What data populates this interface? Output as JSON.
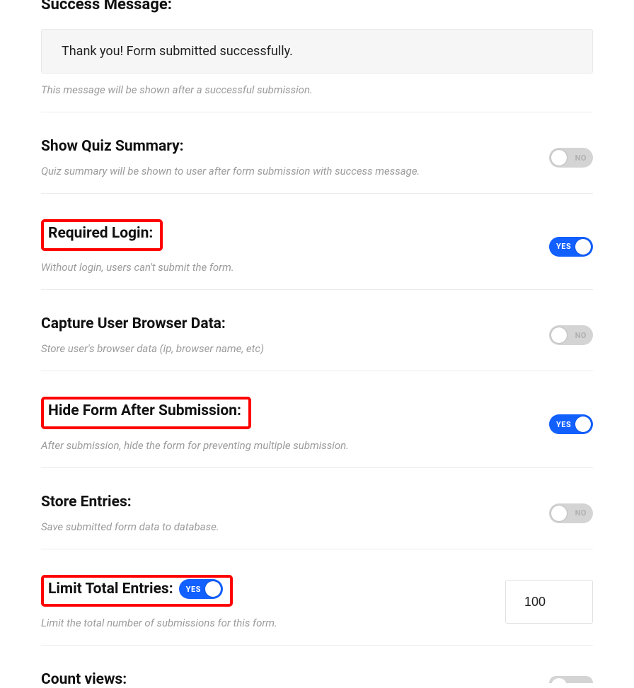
{
  "successMessageSection": {
    "title": "Success Message:",
    "value": "Thank you! Form submitted successfully.",
    "help": "This message will be shown after a successful submission."
  },
  "toggleLabels": {
    "yes": "YES",
    "no": "NO"
  },
  "settings": {
    "quizSummary": {
      "title": "Show Quiz Summary:",
      "help": "Quiz summary will be shown to user after form submission with success message.",
      "on": false
    },
    "requiredLogin": {
      "title": "Required Login:",
      "help": "Without login, users can't submit the form.",
      "on": true
    },
    "captureBrowser": {
      "title": "Capture User Browser Data:",
      "help": "Store user's browser data (ip, browser name, etc)",
      "on": false
    },
    "hideAfterSubmit": {
      "title": "Hide Form After Submission:",
      "help": "After submission, hide the form for preventing multiple submission.",
      "on": true
    },
    "storeEntries": {
      "title": "Store Entries:",
      "help": "Save submitted form data to database.",
      "on": false
    },
    "limitEntries": {
      "title": "Limit Total Entries:",
      "help": "Limit the total number of submissions for this form.",
      "on": true,
      "value": "100"
    },
    "countViews": {
      "title": "Count views:",
      "on": false
    }
  }
}
